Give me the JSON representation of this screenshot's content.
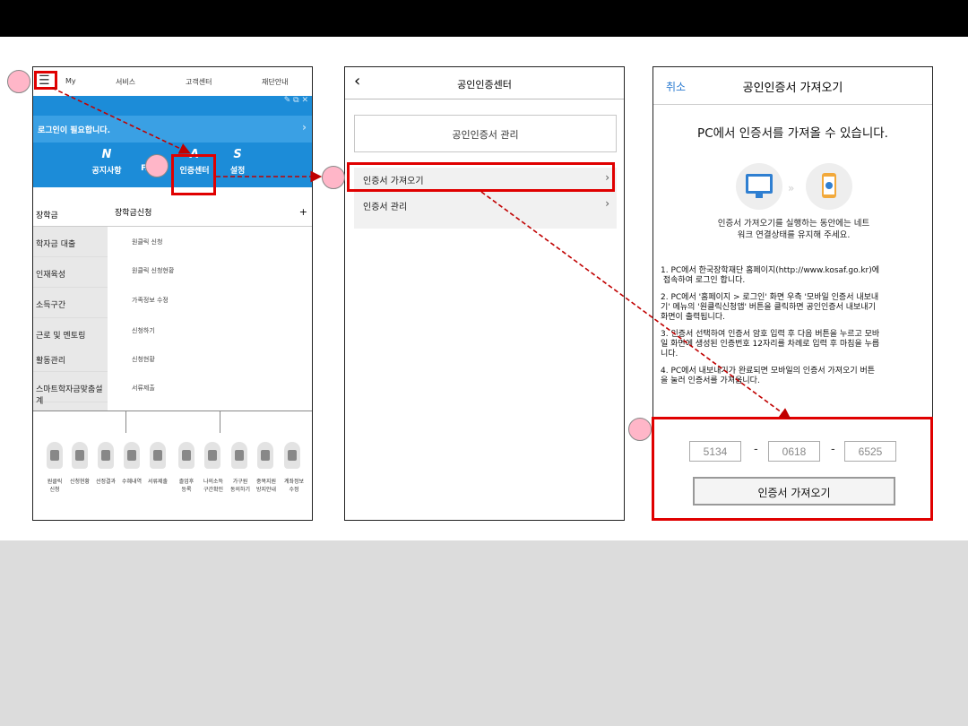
{
  "colors": {
    "header_bg": "#000000",
    "blue": "#1c8cd8",
    "callout": "#e00000",
    "link": "#2b7bd1"
  },
  "screen1": {
    "nav": {
      "menu_icon": "hamburger-icon",
      "my": "My",
      "service": "서비스",
      "support": "고객센터",
      "foundation": "재단안내"
    },
    "login_text": "로그인이 필요합니다.",
    "menu": [
      {
        "letter": "N",
        "label": "공지사항"
      },
      {
        "letter": "",
        "label": "FAQ"
      },
      {
        "letter": "A",
        "label": "인증센터"
      },
      {
        "letter": "S",
        "label": "설정"
      }
    ],
    "left_header": "장학금",
    "right_header": "장학금신청",
    "left_items": [
      "학자금 대출",
      "인재육성",
      "소득구간",
      "근로 및 멘토링",
      "활동관리",
      "스마트학자금맞춤설계"
    ],
    "right_items": [
      "원클릭 신청",
      "원클릭 신청현황",
      "가족정보 수정",
      "신청하기",
      "신청현황",
      "서류제출"
    ],
    "icons": [
      {
        "icon": "magnifier-icon",
        "label": "원클릭\n신청"
      },
      {
        "icon": "document-icon",
        "label": "신청현황"
      },
      {
        "icon": "search-doc-icon",
        "label": "선정결과"
      },
      {
        "icon": "receipt-icon",
        "label": "수혜내역"
      },
      {
        "icon": "upload-icon",
        "label": "서류제출"
      },
      {
        "icon": "calendar-icon",
        "label": "졸업후\n등록"
      },
      {
        "icon": "income-icon",
        "label": "나의소득\n구간확인"
      },
      {
        "icon": "family-icon",
        "label": "가구원\n동의하기"
      },
      {
        "icon": "copy-icon",
        "label": "중복지원\n방지안내"
      },
      {
        "icon": "bank-icon",
        "label": "계좌정보\n수정"
      }
    ]
  },
  "screen2": {
    "title": "공인인증센터",
    "manage_button": "공인인증서 관리",
    "rows": [
      {
        "label": "인증서 가져오기"
      },
      {
        "label": "인증서 관리"
      }
    ]
  },
  "screen3": {
    "cancel": "취소",
    "title": "공인인증서 가져오기",
    "heading": "PC에서 인증서를 가져올 수  있습니다.",
    "notice_line1": "인증서 가져오기를 실행하는 동안에는 네트",
    "notice_line2": "워크 연결상태를 유지해 주세요.",
    "steps": [
      "1. PC에서 한국장학재단 홈페이지(http://www.kosaf.go.kr)에\n 접속하여 로그인 합니다.",
      "2. PC에서 '홈페이지 > 로그인' 화면 우측 '모바일 인증서 내보내\n기' 메뉴의 '원클릭신청앱' 버튼을 클릭하면 공인인증서 내보내기\n화면이 출력됩니다.",
      "3. 인증서 선택하여 인증서 암호 입력 후 다음 버튼을 누르고 모바\n일 화면에 생성된 인증번호 12자리를 차례로 입력 후 마침을 누릅\n니다.",
      "4. PC에서 내보내기가 완료되면 모바일의 인증서 가져오기 버튼\n을 눌러 인증서를 가져옵니다."
    ],
    "codes": [
      "5134",
      "0618",
      "6525"
    ],
    "dash": "-",
    "import_button": "인증서 가져오기"
  }
}
